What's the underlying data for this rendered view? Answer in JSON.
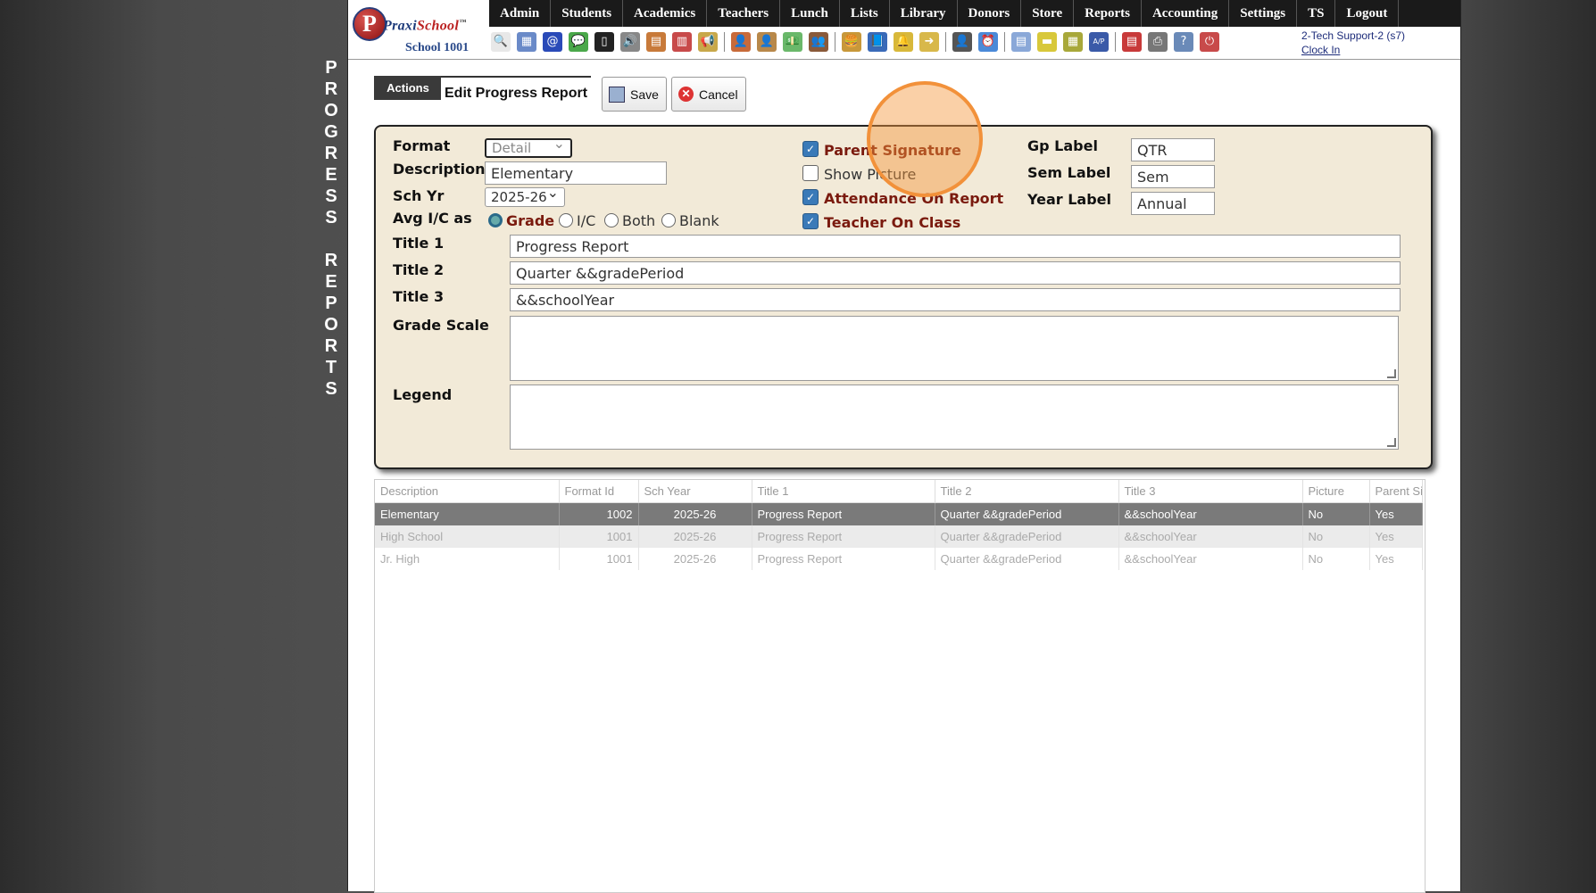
{
  "sidebar_title": [
    "P",
    "R",
    "O",
    "G",
    "R",
    "E",
    "S",
    "S",
    "",
    "R",
    "E",
    "P",
    "O",
    "R",
    "T",
    "S"
  ],
  "logo": {
    "initial": "P",
    "brand_a": "Praxi",
    "brand_b": "School",
    "tm": "™",
    "school": "School 1001"
  },
  "nav": [
    "Admin",
    "Students",
    "Academics",
    "Teachers",
    "Lunch",
    "Lists",
    "Library",
    "Donors",
    "Store",
    "Reports",
    "Accounting",
    "Settings",
    "TS",
    "Logout"
  ],
  "toolbar_icons": [
    {
      "name": "search-icon",
      "glyph": "🔍",
      "color": "#e8e8e8"
    },
    {
      "name": "calendar-grid-icon",
      "glyph": "▦",
      "color": "#6a8ac8"
    },
    {
      "name": "email-icon",
      "glyph": "@",
      "color": "#2a4ab8"
    },
    {
      "name": "chat-icon",
      "glyph": "💬",
      "color": "#4aa84a"
    },
    {
      "name": "phone-icon",
      "glyph": "▯",
      "color": "#222"
    },
    {
      "name": "speaker-icon",
      "glyph": "🔊",
      "color": "#888"
    },
    {
      "name": "grid-icon",
      "glyph": "▤",
      "color": "#c87a3a"
    },
    {
      "name": "calendar-icon",
      "glyph": "▥",
      "color": "#c84a4a"
    },
    {
      "name": "megaphone-icon",
      "glyph": "📢",
      "color": "#c8a84a"
    },
    {
      "sep": true
    },
    {
      "name": "teacher-icon",
      "glyph": "👤",
      "color": "#c86a3a"
    },
    {
      "name": "student-icon",
      "glyph": "👤",
      "color": "#b8884a"
    },
    {
      "name": "money-icon",
      "glyph": "💵",
      "color": "#6ab86a"
    },
    {
      "name": "group-icon",
      "glyph": "👥",
      "color": "#8a5a3a"
    },
    {
      "sep": true
    },
    {
      "name": "burger-icon",
      "glyph": "🍔",
      "color": "#c8983a"
    },
    {
      "name": "book-icon",
      "glyph": "📘",
      "color": "#3a6ab8"
    },
    {
      "name": "bell-icon",
      "glyph": "🔔",
      "color": "#d8b83a"
    },
    {
      "name": "export-icon",
      "glyph": "➜",
      "color": "#d8b84a"
    },
    {
      "sep": true
    },
    {
      "name": "staff-icon",
      "glyph": "👤",
      "color": "#555"
    },
    {
      "name": "clock-icon",
      "glyph": "⏰",
      "color": "#4a8ad8"
    },
    {
      "sep": true
    },
    {
      "name": "report-icon",
      "glyph": "▤",
      "color": "#8aa8d8"
    },
    {
      "name": "card-icon",
      "glyph": "▬",
      "color": "#d8c83a"
    },
    {
      "name": "cash-register-icon",
      "glyph": "▦",
      "color": "#a8a83a"
    },
    {
      "name": "ap-icon",
      "glyph": "A/P",
      "color": "#3a5aa8"
    },
    {
      "sep": true
    },
    {
      "name": "pdf-icon",
      "glyph": "▤",
      "color": "#c83a3a"
    },
    {
      "name": "printer-icon",
      "glyph": "⎙",
      "color": "#777"
    },
    {
      "name": "help-icon",
      "glyph": "?",
      "color": "#6a8ab8"
    },
    {
      "name": "power-icon",
      "glyph": "⏻",
      "color": "#c84a4a"
    }
  ],
  "user": {
    "name": "2-Tech Support-2 (s7)",
    "clock_in": "Clock In"
  },
  "actions": {
    "actions_label": "Actions",
    "edit_title": "Edit Progress Report",
    "save_label": "Save",
    "cancel_label": "Cancel"
  },
  "form": {
    "format_label": "Format",
    "format_value": "Detail",
    "description_label": "Description",
    "description_value": "Elementary",
    "sch_yr_label": "Sch Yr",
    "sch_yr_value": "2025-26",
    "avg_label": "Avg I/C as",
    "avg_options": [
      "Grade",
      "I/C",
      "Both",
      "Blank"
    ],
    "avg_selected": "Grade",
    "title1_label": "Title 1",
    "title1_value": "Progress Report",
    "title2_label": "Title 2",
    "title2_value": "Quarter &&gradePeriod",
    "title3_label": "Title 3",
    "title3_value": "&&schoolYear",
    "grade_scale_label": "Grade Scale",
    "grade_scale_value": "",
    "legend_label": "Legend",
    "legend_value": "",
    "checkboxes": [
      {
        "label": "Parent Signature",
        "checked": true
      },
      {
        "label": "Show Picture",
        "checked": false
      },
      {
        "label": "Attendance On Report",
        "checked": true
      },
      {
        "label": "Teacher On Class",
        "checked": true
      }
    ],
    "gp_label": "Gp Label",
    "gp_value": "QTR",
    "sem_label": "Sem Label",
    "sem_value": "Sem",
    "year_label": "Year Label",
    "year_value": "Annual"
  },
  "grid": {
    "columns": [
      "Description",
      "Format Id",
      "Sch Year",
      "Title 1",
      "Title 2",
      "Title 3",
      "Picture",
      "Parent Sig"
    ],
    "rows": [
      {
        "description": "Elementary",
        "format_id": "1002",
        "sch_year": "2025-26",
        "title1": "Progress Report",
        "title2": "Quarter &&gradePeriod",
        "title3": "&&schoolYear",
        "picture": "No",
        "parent_sig": "Yes"
      },
      {
        "description": "High School",
        "format_id": "1001",
        "sch_year": "2025-26",
        "title1": "Progress Report",
        "title2": "Quarter &&gradePeriod",
        "title3": "&&schoolYear",
        "picture": "No",
        "parent_sig": "Yes"
      },
      {
        "description": "Jr. High",
        "format_id": "1001",
        "sch_year": "2025-26",
        "title1": "Progress Report",
        "title2": "Quarter &&gradePeriod",
        "title3": "&&schoolYear",
        "picture": "No",
        "parent_sig": "Yes"
      }
    ],
    "selected_row": 0
  }
}
